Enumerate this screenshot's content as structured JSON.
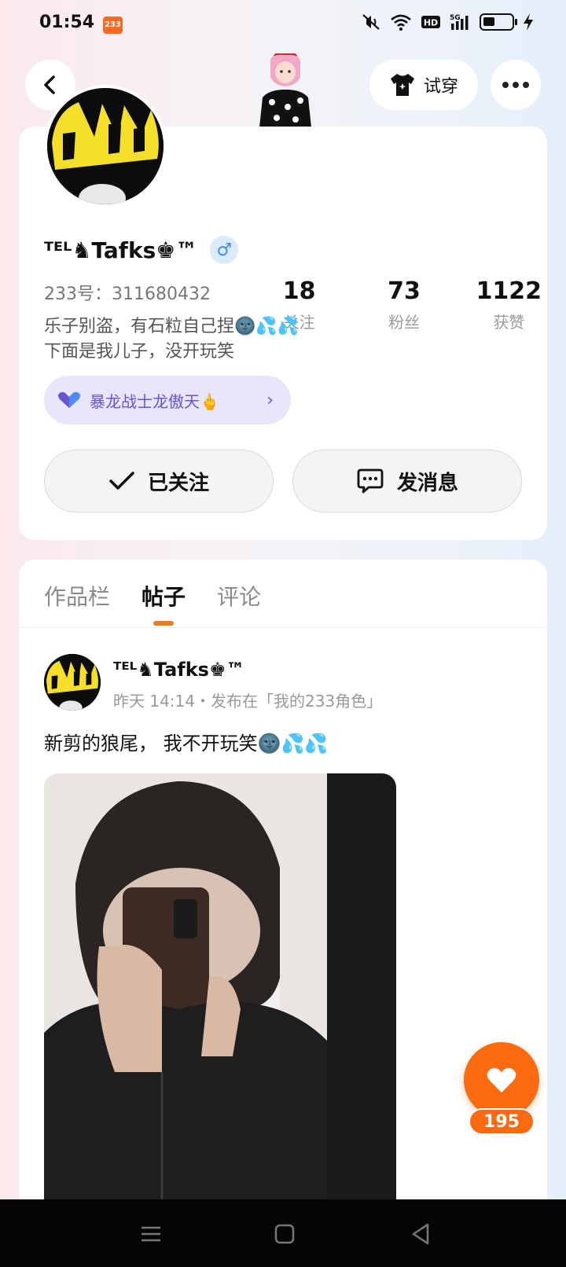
{
  "status_bar": {
    "time": "01:54",
    "app_badge": "233"
  },
  "header": {
    "tryon_label": "试穿"
  },
  "profile": {
    "stats": [
      {
        "value": "18",
        "label": "关注"
      },
      {
        "value": "73",
        "label": "粉丝"
      },
      {
        "value": "1122",
        "label": "获赞"
      }
    ],
    "username": "ᵀᴱᴸ♞Tafks♚™",
    "gender_symbol": "♂",
    "user_id": "233号：311680432",
    "bio_line1": "乐子别盗，有石粒自己捏🌚💦💦",
    "bio_line2": "下面是我儿子，没开玩笑",
    "title_badge": "暴龙战士龙傲天🖕",
    "follow_label": "已关注",
    "message_label": "发消息"
  },
  "tabs": [
    {
      "label": "作品栏",
      "active": false
    },
    {
      "label": "帖子",
      "active": true
    },
    {
      "label": "评论",
      "active": false
    }
  ],
  "post": {
    "author": "ᵀᴱᴸ♞Tafks♚™",
    "meta": "昨天 14:14・发布在「我的233角色」",
    "text": "新剪的狼尾， 我不开玩笑🌚💦💦"
  },
  "like": {
    "count": "195"
  },
  "colors": {
    "accent_orange": "#fb6a10",
    "badge_purple": "#6a55d0",
    "gender_blue": "#3d8ef0"
  }
}
